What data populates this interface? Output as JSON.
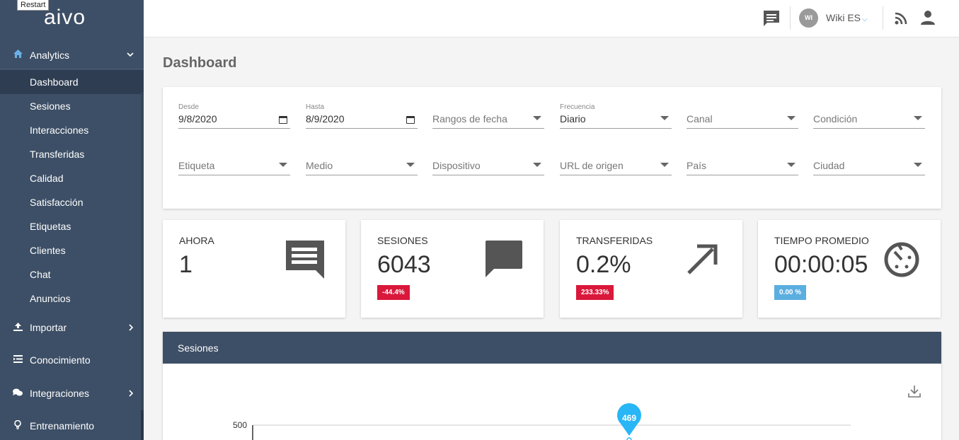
{
  "tooltip": "Restart",
  "sidebar": {
    "logo": "aivo",
    "analytics": {
      "label": "Analytics",
      "icon": "home-icon"
    },
    "submenu": [
      {
        "label": "Dashboard",
        "active": true
      },
      {
        "label": "Sesiones"
      },
      {
        "label": "Interacciones"
      },
      {
        "label": "Transferidas"
      },
      {
        "label": "Calidad"
      },
      {
        "label": "Satisfacción"
      },
      {
        "label": "Etiquetas"
      },
      {
        "label": "Clientes"
      },
      {
        "label": "Chat"
      },
      {
        "label": "Anuncios"
      }
    ],
    "importar": {
      "label": "Importar",
      "icon": "upload-icon"
    },
    "conocimiento": {
      "label": "Conocimiento",
      "icon": "list-icon"
    },
    "integraciones": {
      "label": "Integraciones",
      "icon": "chat-bubbles-icon"
    },
    "entrenamiento": {
      "label": "Entrenamiento",
      "icon": "lightbulb-icon"
    }
  },
  "topbar": {
    "avatar_initials": "WI",
    "user": "Wiki ES"
  },
  "page_title": "Dashboard",
  "filters": {
    "desde": {
      "label": "Desde",
      "value": "9/8/2020"
    },
    "hasta": {
      "label": "Hasta",
      "value": "8/9/2020"
    },
    "rangos": "Rangos de fecha",
    "frecuencia": {
      "label": "Frecuencia",
      "value": "Diario"
    },
    "canal": "Canal",
    "condicion": "Condición",
    "etiqueta": "Etiqueta",
    "medio": "Medio",
    "dispositivo": "Dispositivo",
    "url": "URL de origen",
    "pais": "País",
    "ciudad": "Ciudad"
  },
  "stats": {
    "ahora": {
      "label": "AHORA",
      "value": "1"
    },
    "sesiones": {
      "label": "SESIONES",
      "value": "6043",
      "badge": "-44.4%"
    },
    "transferidas": {
      "label": "TRANSFERIDAS",
      "value": "0.2%",
      "badge": "233.33%"
    },
    "tiempo": {
      "label": "TIEMPO PROMEDIO",
      "value": "00:00:05",
      "badge": "0.00 %"
    }
  },
  "colors": {
    "sidebar": "#3d4f66",
    "badge_red": "#d9183b",
    "badge_blue": "#5aaee0",
    "marker": "#29b6f6"
  },
  "chart": {
    "title": "Sesiones",
    "y_tick": "500",
    "marker_label": "469"
  }
}
